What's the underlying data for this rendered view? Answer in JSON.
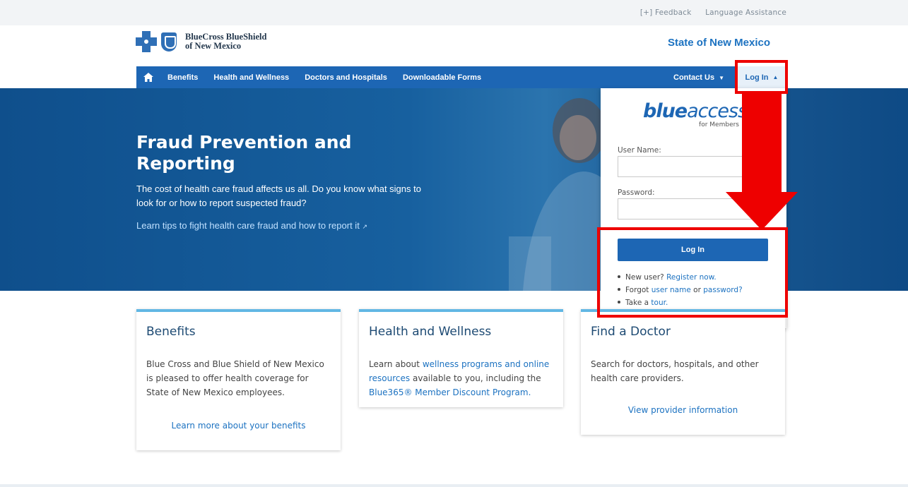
{
  "utility": {
    "feedback": "[+] Feedback",
    "language": "Language Assistance"
  },
  "header": {
    "logo_line1": "BlueCross BlueShield",
    "logo_line2": "of New Mexico",
    "state": "State of New Mexico"
  },
  "nav": {
    "home_icon": "home-icon",
    "items": [
      "Benefits",
      "Health and Wellness",
      "Doctors and Hospitals",
      "Downloadable Forms"
    ],
    "contact": "Contact Us",
    "login": "Log In"
  },
  "hero": {
    "title": "Fraud Prevention and Reporting",
    "text": "The cost of health care fraud affects us all. Do you know what signs to look for or how to report suspected fraud?",
    "link": "Learn tips to fight health care fraud and how to report it"
  },
  "login_panel": {
    "brand_a": "blue",
    "brand_b": "access",
    "brand_sub": "for Members",
    "username_label": "User Name:",
    "username_value": "",
    "password_label": "Password:",
    "password_value": "",
    "button": "Log In",
    "new_user_prefix": "New user?",
    "register": "Register now.",
    "forgot_prefix": "Forgot",
    "user_name": "user name",
    "or": "or",
    "password": "password?",
    "take_a": "Take a",
    "tour": "tour."
  },
  "cards": [
    {
      "title": "Benefits",
      "body": "Blue Cross and Blue Shield of New Mexico is pleased to offer health coverage for State of New Mexico employees.",
      "link": "Learn more about your benefits"
    },
    {
      "title": "Health and Wellness",
      "body_prefix": "Learn about",
      "body_link1": "wellness programs and online resources",
      "body_mid": "available to you, including the",
      "body_link2": "Blue365® Member Discount Program."
    },
    {
      "title": "Find a Doctor",
      "body": "Search for doctors, hospitals, and other health care providers.",
      "link": "View provider information"
    }
  ],
  "colors": {
    "nav_blue": "#1d66b4",
    "accent_red": "#ee0000",
    "card_top": "#62b7e4",
    "link_blue": "#1c72c1"
  }
}
